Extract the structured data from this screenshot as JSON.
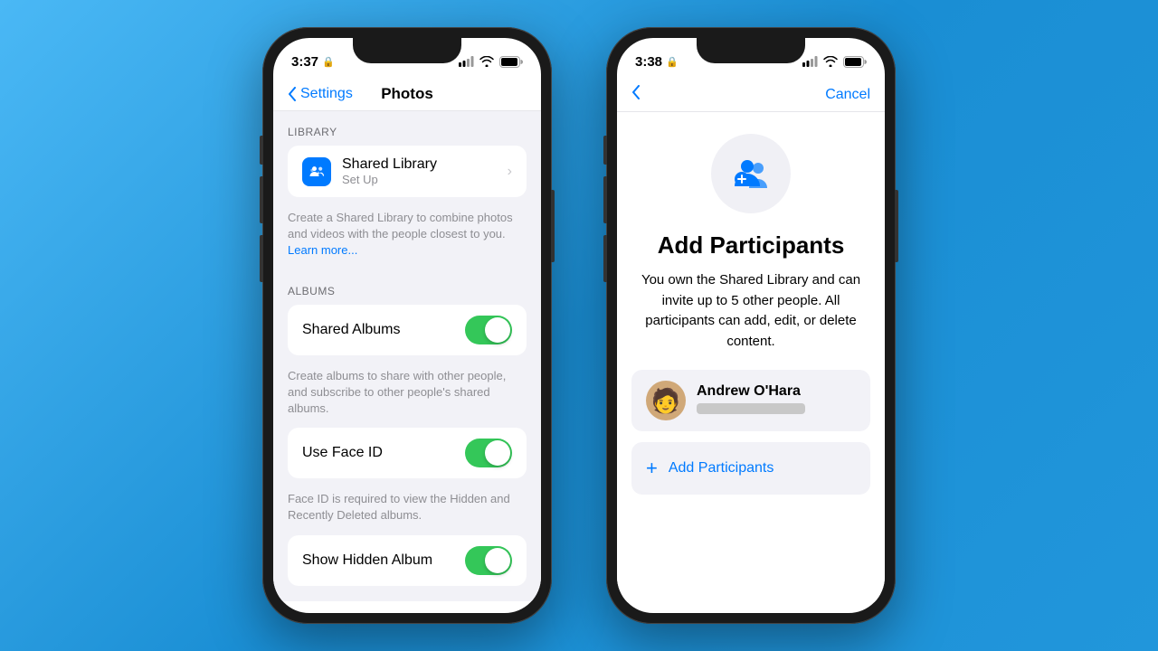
{
  "left_phone": {
    "status": {
      "time": "3:37",
      "lock_icon": "🔒",
      "signal": "signal",
      "wifi": "wifi",
      "battery": "battery"
    },
    "nav": {
      "back_label": "Settings",
      "title": "Photos"
    },
    "library_section": {
      "header": "LIBRARY",
      "shared_library": {
        "title": "Shared Library",
        "subtitle": "Set Up",
        "has_chevron": true
      },
      "description": "Create a Shared Library to combine photos and videos with the people closest to you.",
      "learn_more": "Learn more..."
    },
    "albums_section": {
      "header": "ALBUMS",
      "shared_albums": {
        "title": "Shared Albums",
        "toggle_on": true
      },
      "albums_description": "Create albums to share with other people, and subscribe to other people's shared albums.",
      "use_face_id": {
        "title": "Use Face ID",
        "toggle_on": true
      },
      "face_id_description": "Face ID is required to view the Hidden and Recently Deleted albums.",
      "show_hidden": {
        "title": "Show Hidden Album",
        "toggle_on": true
      }
    }
  },
  "right_phone": {
    "status": {
      "time": "3:38",
      "lock_icon": "🔒",
      "signal": "signal",
      "wifi": "wifi",
      "battery": "battery"
    },
    "nav": {
      "cancel_label": "Cancel"
    },
    "add_participants": {
      "title": "Add Participants",
      "description": "You own the Shared Library and can invite up to 5 other people. All participants can add, edit, or delete content.",
      "participant": {
        "name": "Andrew O'Hara",
        "email_placeholder": "••••••••••••••"
      },
      "add_button": "Add Participants"
    }
  }
}
